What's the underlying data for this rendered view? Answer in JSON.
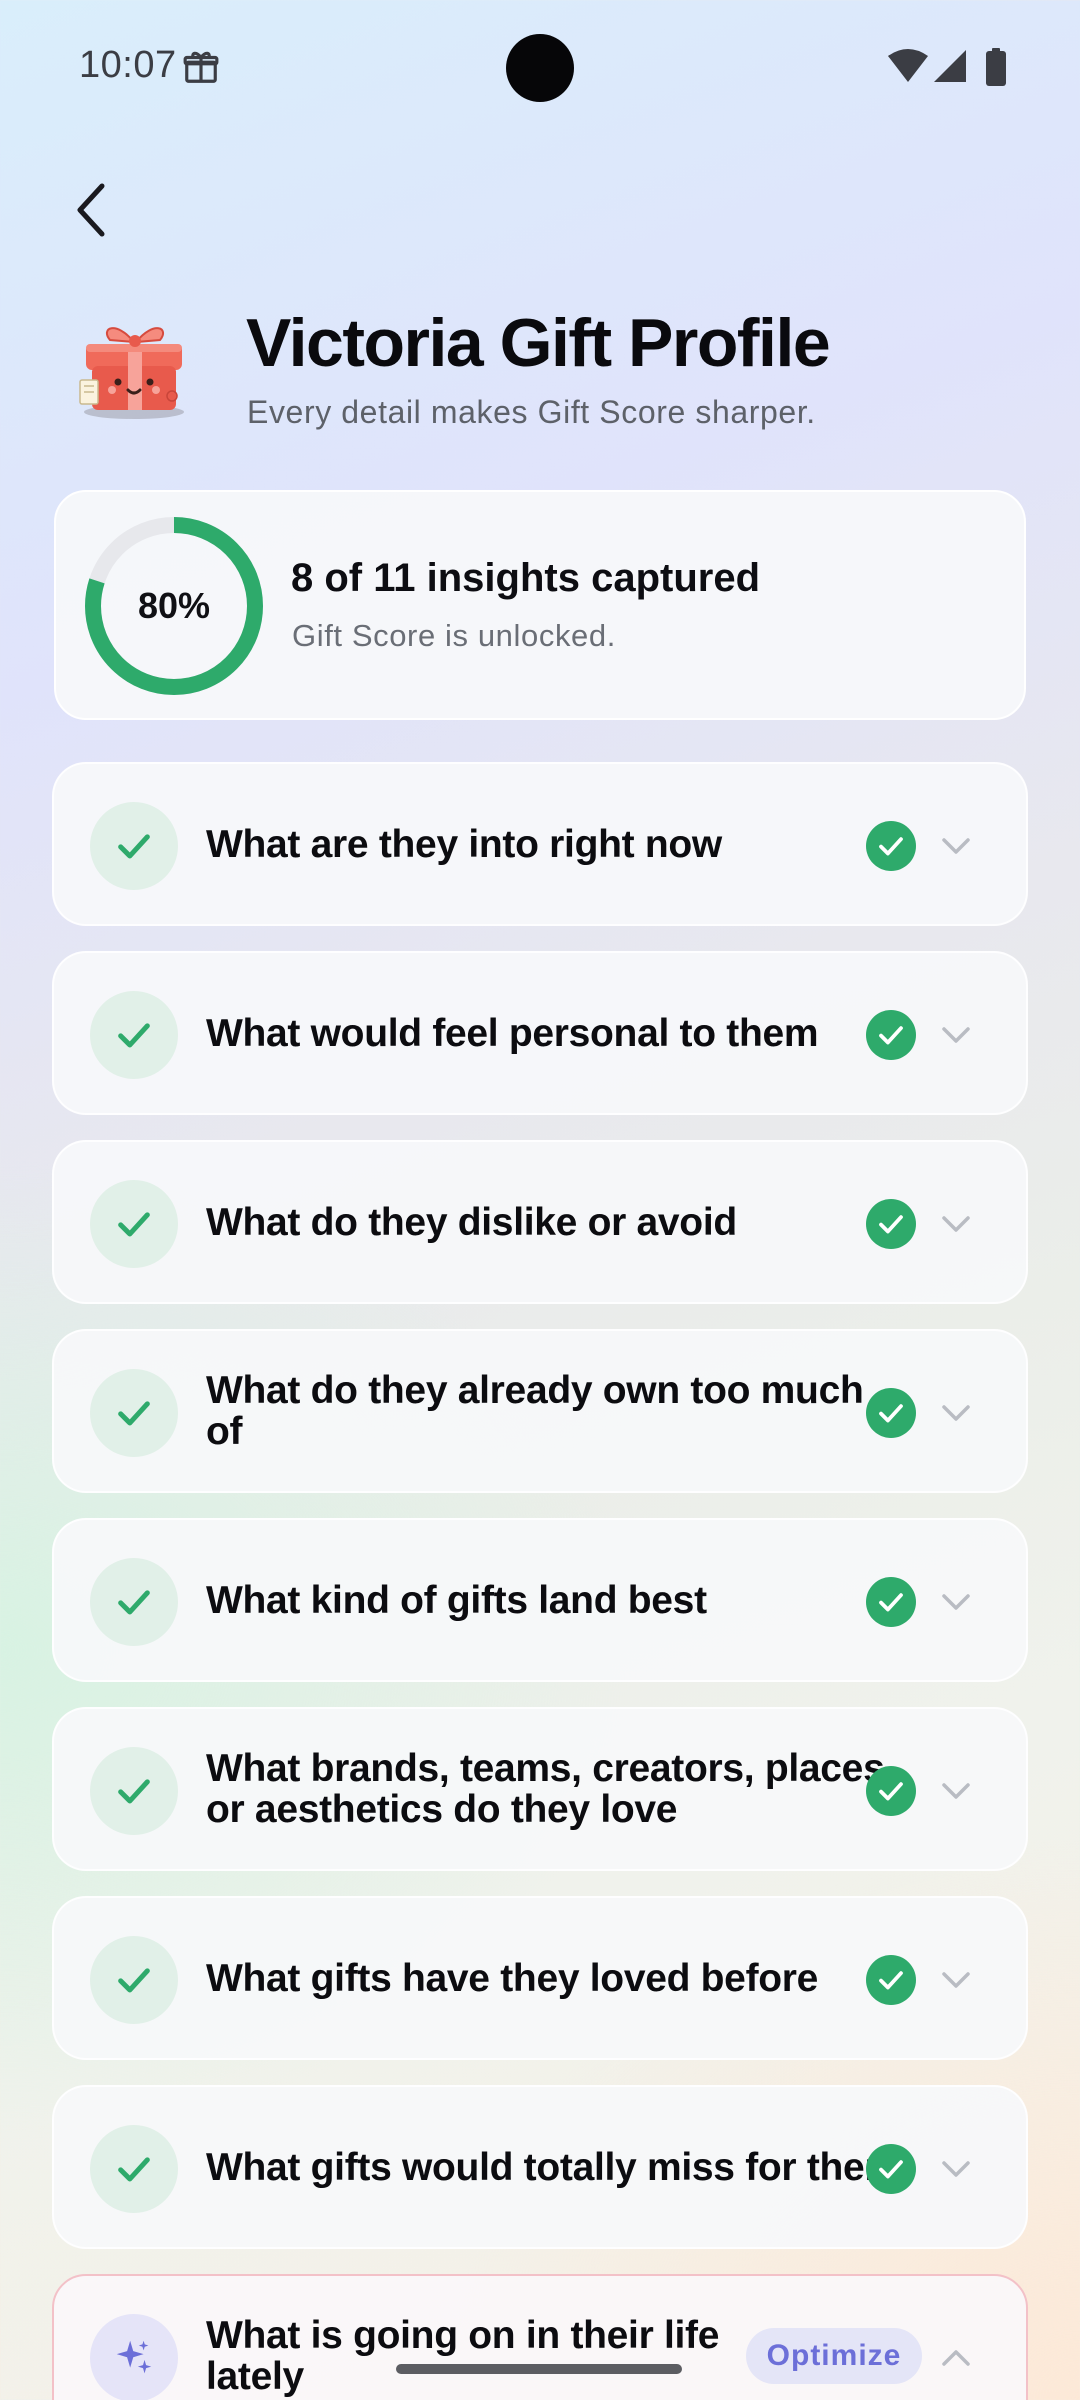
{
  "status_bar": {
    "time": "10:07",
    "icons": [
      "gift-icon",
      "wifi-icon",
      "signal-icon",
      "battery-icon"
    ]
  },
  "header": {
    "back_icon": "back-arrow-icon",
    "illustration": "gift-box-mascot",
    "title": "Victoria Gift Profile",
    "subtitle": "Every detail makes Gift Score sharper."
  },
  "progress": {
    "percent_label": "80%",
    "fraction": 0.8,
    "title": "8 of 11 insights captured",
    "subtitle": "Gift Score is unlocked."
  },
  "questions": [
    {
      "text": "What are they into right now",
      "completed": true
    },
    {
      "text": "What would feel personal to them",
      "completed": true
    },
    {
      "text": "What do they dislike or avoid",
      "completed": true
    },
    {
      "text": "What do they already own too much of",
      "completed": true
    },
    {
      "text": "What kind of gifts land best",
      "completed": true
    },
    {
      "text": "What brands, teams, creators, places, or aesthetics do they love",
      "completed": true
    },
    {
      "text": "What gifts have they loved before",
      "completed": true
    },
    {
      "text": "What gifts would totally miss for them",
      "completed": true
    },
    {
      "text": "What is going on in their life lately",
      "completed": false,
      "action": "Optimize",
      "expanded": true
    }
  ],
  "colors": {
    "accent_green": "#2eaa6b",
    "accent_purple": "#6c6fd8",
    "active_border": "#f3c1c8"
  }
}
